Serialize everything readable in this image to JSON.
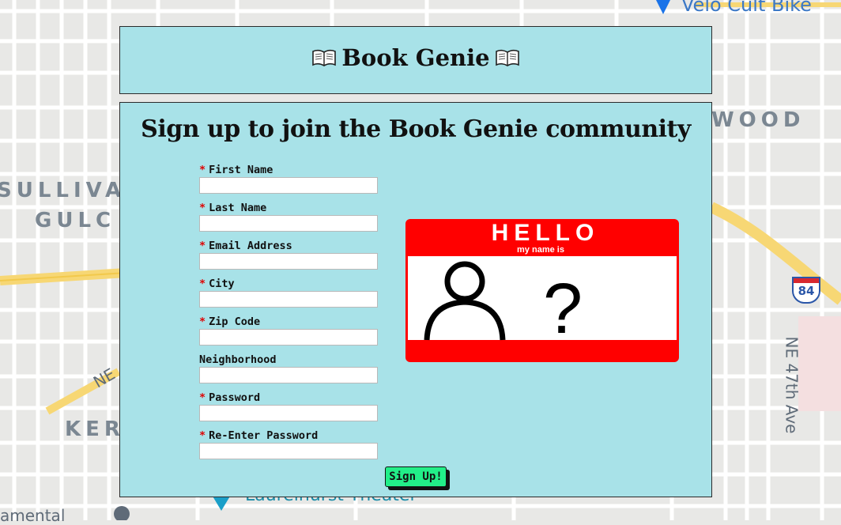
{
  "map": {
    "labels": {
      "velo": "Velo Cult Bike",
      "wood": "WOOD",
      "sullivan": "SULLIVA",
      "gulch": "GULC",
      "ne": "NE",
      "kerns": "KER",
      "ne47": "NE 47th Ave",
      "highway": "84",
      "theater": "Laurelhurst Theater",
      "bottom_left": "amental"
    }
  },
  "header": {
    "title": "Book Genie"
  },
  "signup": {
    "heading": "Sign up to join the Book Genie community",
    "required_marker": "*",
    "fields": [
      {
        "label": "First Name",
        "required": true,
        "value": ""
      },
      {
        "label": "Last Name",
        "required": true,
        "value": ""
      },
      {
        "label": "Email Address",
        "required": true,
        "value": ""
      },
      {
        "label": "City",
        "required": true,
        "value": ""
      },
      {
        "label": "Zip Code",
        "required": true,
        "value": ""
      },
      {
        "label": "Neighborhood",
        "required": false,
        "value": ""
      },
      {
        "label": "Password",
        "required": true,
        "value": ""
      },
      {
        "label": "Re-Enter Password",
        "required": true,
        "value": ""
      }
    ],
    "name_tag": {
      "hello": "HELLO",
      "subtitle": "my name is",
      "mark": "?"
    },
    "button_label": "Sign Up!"
  },
  "colors": {
    "panel_bg": "#a8e2e8",
    "button_bg": "#22ee88",
    "required": "#e00000",
    "tag_red": "#ff0000"
  }
}
